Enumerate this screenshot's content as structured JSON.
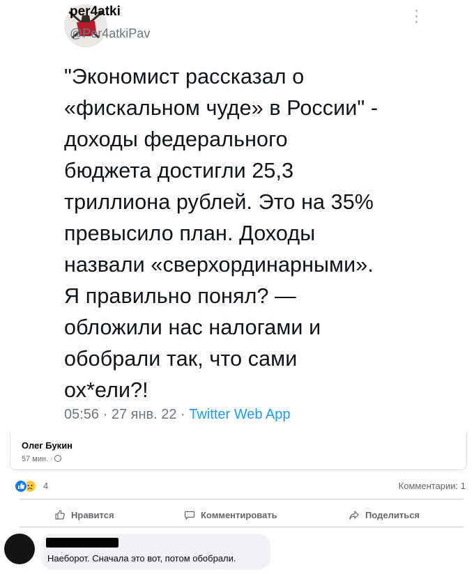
{
  "tweet": {
    "name": "per4atki",
    "handle": "@Per4atkiPav",
    "text": "\"Экономист рассказал о\n«фискальном чуде» в России\" -\nдоходы федерального\nбюджета достигли 25,3\nтриллиона рублей. Это на 35%\nпревысило план. Доходы\nназвали «сверхординарными».\n   Я правильно понял? —\nобложили нас налогами и\nобобрали так, что сами\nох*ели?!",
    "time": "05:56 · 27 янв. 22 · ",
    "app": "Twitter Web App",
    "menu_icon": "vertical-dots-icon"
  },
  "attribution": {
    "author": "Олег Букин",
    "time": "57 мин. ·",
    "privacy_icon": "globe-icon"
  },
  "reactions": {
    "count": "4",
    "icons": [
      "like-icon",
      "sad-icon"
    ],
    "comments": "Комментарии: 1"
  },
  "actions": {
    "like": "Нравится",
    "comment": "Комментировать",
    "share": "Поделиться"
  },
  "comment": {
    "text": "Наеборот. Сначала это вот, потом обобрали."
  },
  "colors": {
    "twitter_blue": "#1d9bf0",
    "fb_blue": "#1877f2",
    "muted": "#65676b"
  }
}
